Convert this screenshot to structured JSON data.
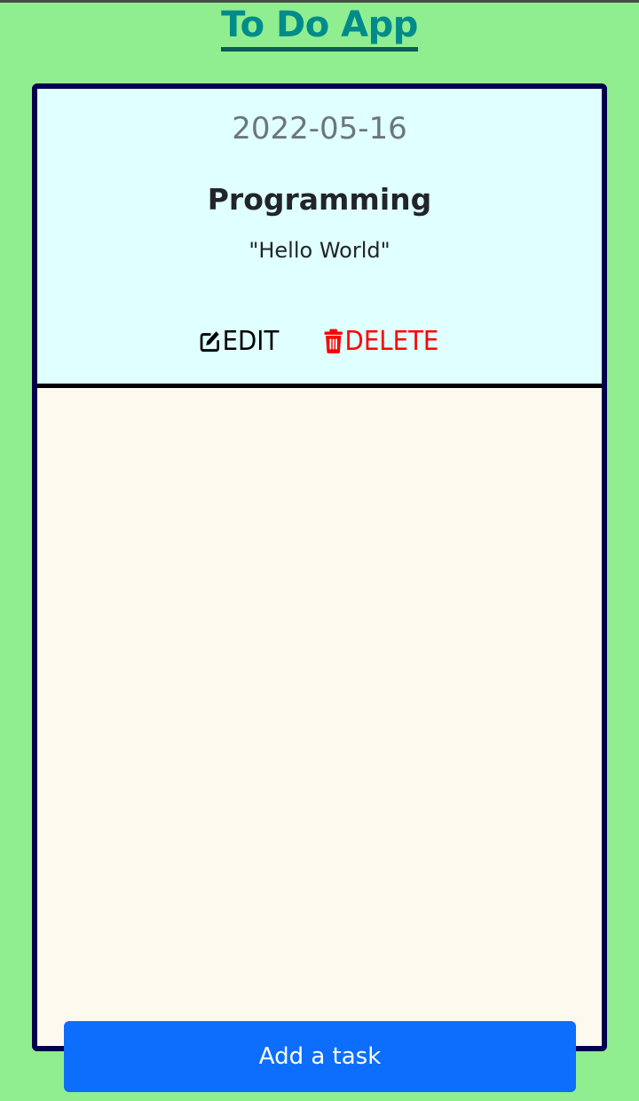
{
  "app": {
    "title": "To Do App"
  },
  "tasks": [
    {
      "date": "2022-05-16",
      "title": "Programming",
      "description": "\"Hello World\"",
      "edit_label": "EDIT",
      "delete_label": "DELETE"
    }
  ],
  "footer": {
    "add_label": "Add a task"
  },
  "icons": {
    "edit": "edit-icon",
    "delete": "trash-icon"
  },
  "colors": {
    "page_background": "#90ee90",
    "title": "#008b8b",
    "board_border": "#00004d",
    "card_background": "#e0ffff",
    "board_background": "#fdf9ee",
    "delete": "#ff0000",
    "primary_button": "#0d6efd"
  }
}
